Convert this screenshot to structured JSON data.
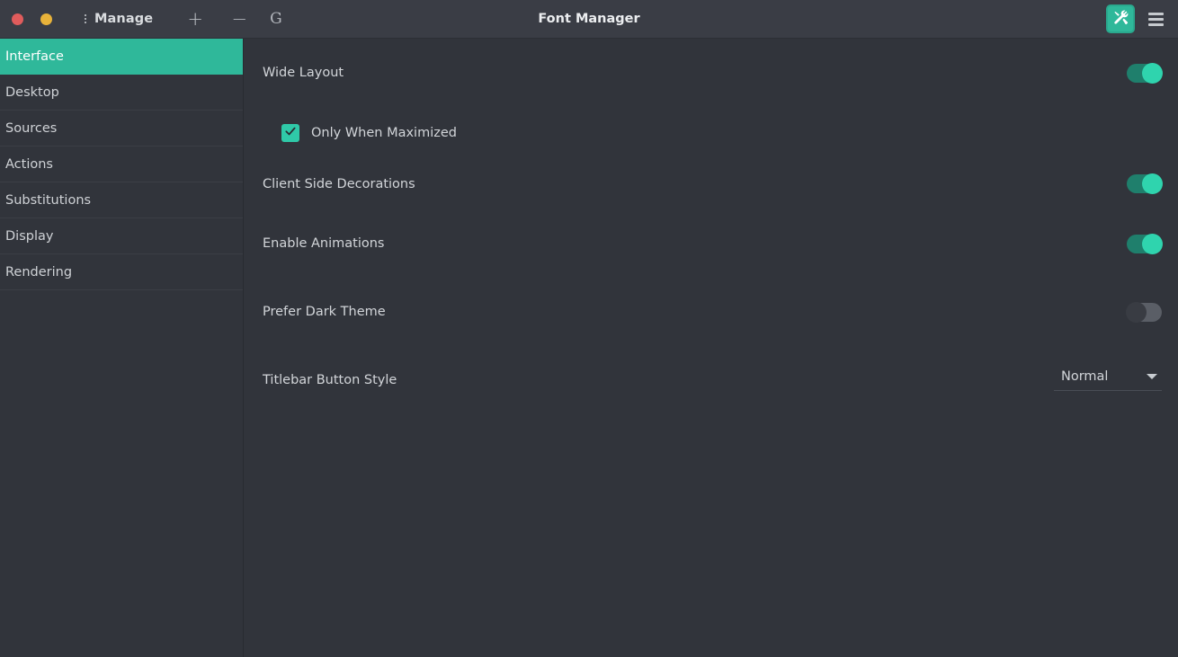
{
  "window": {
    "title": "Font Manager",
    "close_label": "close-window",
    "minimize_label": "minimize-window"
  },
  "titlebar": {
    "manage_label": "Manage",
    "kebab_icon": "vertical-dots-icon",
    "add_label": "+",
    "remove_label": "−",
    "glyph_preview": "G",
    "tools_icon": "tools-icon",
    "menu_icon": "hamburger-menu-icon"
  },
  "sidebar": {
    "items": [
      {
        "label": "Interface",
        "active": true
      },
      {
        "label": "Desktop",
        "active": false
      },
      {
        "label": "Sources",
        "active": false
      },
      {
        "label": "Actions",
        "active": false
      },
      {
        "label": "Substitutions",
        "active": false
      },
      {
        "label": "Display",
        "active": false
      },
      {
        "label": "Rendering",
        "active": false
      }
    ]
  },
  "settings": {
    "wide_layout": {
      "label": "Wide Layout",
      "state": "on"
    },
    "only_when_maximized": {
      "label": "Only When Maximized",
      "checked": true
    },
    "client_side_decorations": {
      "label": "Client Side Decorations",
      "state": "on"
    },
    "enable_animations": {
      "label": "Enable Animations",
      "state": "on"
    },
    "prefer_dark_theme": {
      "label": "Prefer Dark Theme",
      "state": "off"
    },
    "titlebar_button_style": {
      "label": "Titlebar Button Style",
      "value": "Normal"
    }
  },
  "colors": {
    "accent": "#2fb89a",
    "accent_bright": "#2fd4ae",
    "background": "#31343b",
    "titlebar": "#3a3d45",
    "text": "#d2d5d9",
    "close_dot": "#e05c5c",
    "minimize_dot": "#e8b33a"
  }
}
